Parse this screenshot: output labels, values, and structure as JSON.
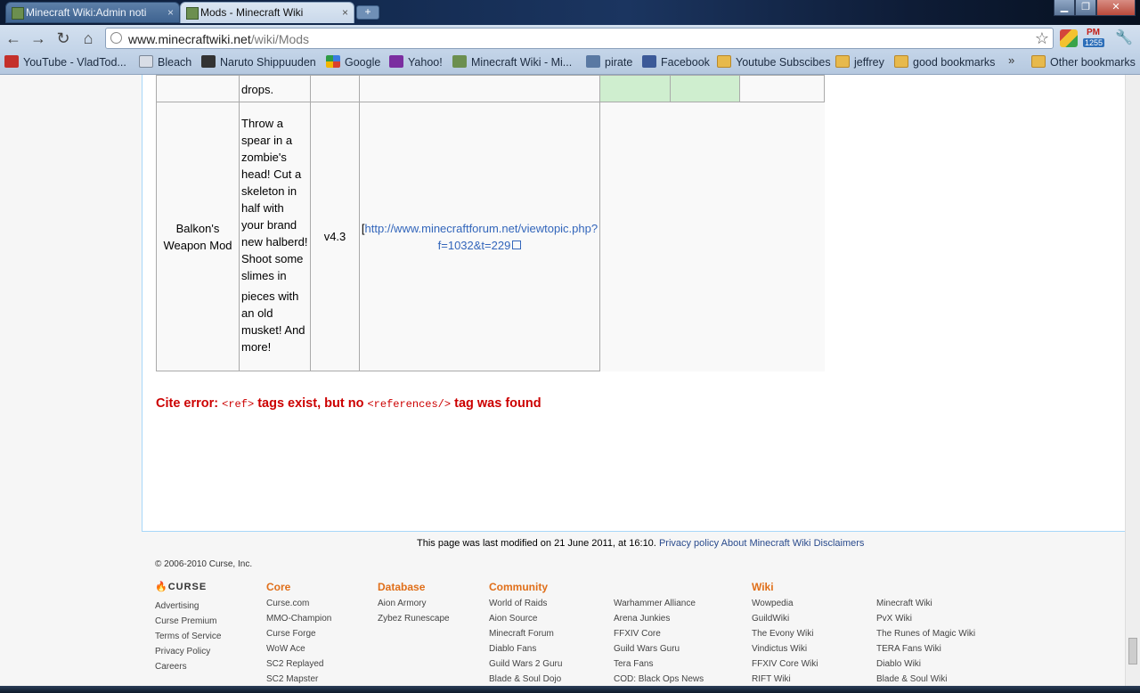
{
  "tabs": [
    {
      "title": "Minecraft Wiki:Admin noti",
      "close": "×"
    },
    {
      "title": "Mods - Minecraft Wiki",
      "close": "×"
    }
  ],
  "window_controls": {
    "minimize": "▁",
    "maximize": "❐",
    "close": "✕"
  },
  "toolbar": {
    "back": "←",
    "forward": "→",
    "reload": "↻",
    "home": "⌂",
    "url_host": "www.minecraftwiki.net",
    "url_path": "/wiki/Mods",
    "star": "☆",
    "pm_label": "PM",
    "pm_count": "1255",
    "wrench": "🔧"
  },
  "bookmarks": [
    {
      "label": "YouTube - VladTod...",
      "icon": "youtube-icon"
    },
    {
      "label": "Bleach",
      "icon": "page-icon"
    },
    {
      "label": "Naruto Shippuuden",
      "icon": "naruto-icon"
    },
    {
      "label": "Google",
      "icon": "google-icon"
    },
    {
      "label": "Yahoo!",
      "icon": "yahoo-icon"
    },
    {
      "label": "Minecraft Wiki - Mi...",
      "icon": "minecraft-icon"
    },
    {
      "label": "pirate",
      "icon": "pirate-icon"
    },
    {
      "label": "Facebook",
      "icon": "facebook-icon"
    },
    {
      "label": "Youtube Subscibes",
      "icon": "folder-icon"
    },
    {
      "label": "jeffrey",
      "icon": "folder-icon"
    },
    {
      "label": "good bookmarks",
      "icon": "folder-icon"
    }
  ],
  "bookmarks_more": "»",
  "other_bookmarks": "Other bookmarks",
  "table": {
    "prev_row_text": "drops.",
    "row": {
      "name": "Balkon's Weapon Mod",
      "description_1": "Throw a spear in a zombie's head! Cut a skeleton in half with your brand new halberd! Shoot some slimes in",
      "description_2": "pieces with an old musket! And more!",
      "version": "v4.3",
      "link_prefix": "[",
      "link_text": "http://www.minecraftforum.net/viewtopic.php?f=1032&t=229"
    }
  },
  "cite_error": {
    "label": "Cite error:",
    "code1": "<ref>",
    "middle": "tags exist, but no",
    "code2": "<references/>",
    "end": "tag was found"
  },
  "footer": {
    "last_modified": "This page was last modified on 21 June 2011, at 16:10.",
    "privacy": "Privacy policy",
    "about": "About Minecraft Wiki",
    "disclaimers": "Disclaimers",
    "copyright": "© 2006-2010 Curse, Inc.",
    "curse_logo": "CURSE",
    "curse_links": [
      "Advertising",
      "Curse Premium",
      "Terms of Service",
      "Privacy Policy",
      "Careers"
    ],
    "core": {
      "heading": "Core",
      "links": [
        "Curse.com",
        "MMO-Champion",
        "Curse Forge",
        "WoW Ace",
        "SC2 Replayed",
        "SC2 Mapster"
      ]
    },
    "database": {
      "heading": "Database",
      "links": [
        "Aion Armory",
        "Zybez Runescape"
      ]
    },
    "community": {
      "heading": "Community",
      "links": [
        "World of Raids",
        "Aion Source",
        "Minecraft Forum",
        "Diablo Fans",
        "Guild Wars 2 Guru",
        "Blade & Soul Dojo"
      ]
    },
    "community2": {
      "links": [
        "Warhammer Alliance",
        "Arena Junkies",
        "FFXIV Core",
        "Guild Wars Guru",
        "Tera Fans",
        "COD: Black Ops News"
      ]
    },
    "wiki": {
      "heading": "Wiki",
      "links": [
        "Wowpedia",
        "GuildWiki",
        "The Evony Wiki",
        "Vindictus Wiki",
        "FFXIV Core Wiki",
        "RIFT Wiki"
      ]
    },
    "wiki2": {
      "links": [
        "Minecraft Wiki",
        "PvX Wiki",
        "The Runes of Magic Wiki",
        "TERA Fans Wiki",
        "Diablo Wiki",
        "Blade & Soul Wiki"
      ]
    }
  },
  "colors": {
    "link": "#3366bb",
    "error": "#cc0000",
    "footer_heading": "#e06f1a",
    "border": "#a7d7f9"
  }
}
